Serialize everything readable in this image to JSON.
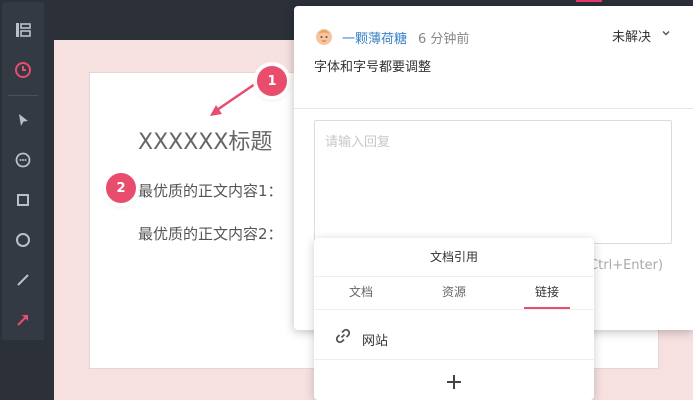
{
  "colors": {
    "accent": "#e84d6e",
    "toolbar_bg": "#2b3039",
    "link_blue": "#3b82c8",
    "canvas_bg": "#f6e0e0"
  },
  "toolbar": {
    "items": [
      {
        "icon": "layers-icon"
      },
      {
        "icon": "clock-icon",
        "color": "#e84d6e"
      },
      {
        "icon": "pointer-icon"
      },
      {
        "icon": "comment-icon"
      },
      {
        "icon": "square-icon"
      },
      {
        "icon": "circle-icon"
      },
      {
        "icon": "line-icon"
      },
      {
        "icon": "arrow-icon",
        "color": "#e84d6e"
      }
    ]
  },
  "slide": {
    "title": "XXXXXX标题",
    "body_line_1": "最优质的正文内容1：",
    "body_line_2": "最优质的正文内容2：",
    "marker_1": "1",
    "marker_2": "2"
  },
  "comment": {
    "avatar_icon": "baby-avatar-icon",
    "username": "一颗薄荷糖",
    "time": "6 分钟前",
    "status": "未解决",
    "text": "字体和字号都要调整",
    "reply_placeholder": "请输入回复",
    "hint": "(Ctrl+Enter)"
  },
  "reference_popup": {
    "title": "文档引用",
    "tabs": [
      "文档",
      "资源",
      "链接"
    ],
    "active_tab": "链接",
    "items": [
      {
        "label": "网站",
        "icon": "link-icon"
      }
    ],
    "add_icon": "plus-icon"
  }
}
